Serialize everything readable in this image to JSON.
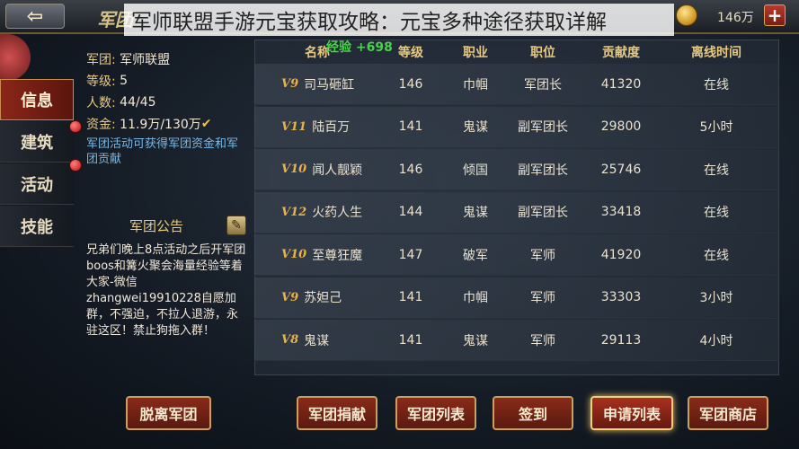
{
  "header": {
    "back_label": "⇦",
    "page_title": "军团",
    "overlay_title": "军师联盟手游元宝获取攻略：元宝多种途径获取详解",
    "currency": "146万",
    "plus_label": "+"
  },
  "sidebar": {
    "items": [
      {
        "label": "信息"
      },
      {
        "label": "建筑"
      },
      {
        "label": "活动"
      },
      {
        "label": "技能"
      }
    ]
  },
  "info": {
    "legion_key": "军团:",
    "legion_val": "军师联盟",
    "level_key": "等级:",
    "level_val": "5",
    "members_key": "人数:",
    "members_val": "44/45",
    "funds_key": "资金:",
    "funds_val": "11.9万/130万",
    "note": "军团活动可获得军团资金和军团贡献"
  },
  "notice": {
    "title": "军团公告",
    "body": "兄弟们晚上8点活动之后开军团boos和篝火聚会海量经验等着大家-微信zhangwei19910228自愿加群，不强迫，不拉人退游，永驻这区！禁止狗拖入群！"
  },
  "exp_tip": "经验 +698",
  "table": {
    "headers": [
      "名称",
      "等级",
      "职业",
      "职位",
      "贡献度",
      "离线时间"
    ],
    "rows": [
      {
        "vip": "V9",
        "name": "司马砸缸",
        "level": "146",
        "job": "巾帼",
        "post": "军团长",
        "contrib": "41320",
        "offline": "在线"
      },
      {
        "vip": "V11",
        "name": "陆百万",
        "level": "141",
        "job": "鬼谋",
        "post": "副军团长",
        "contrib": "29800",
        "offline": "5小时"
      },
      {
        "vip": "V10",
        "name": "闻人靓颖",
        "level": "146",
        "job": "倾国",
        "post": "副军团长",
        "contrib": "25746",
        "offline": "在线"
      },
      {
        "vip": "V12",
        "name": "火药人生",
        "level": "144",
        "job": "鬼谋",
        "post": "副军团长",
        "contrib": "33418",
        "offline": "在线"
      },
      {
        "vip": "V10",
        "name": "至尊狂魔",
        "level": "147",
        "job": "破军",
        "post": "军师",
        "contrib": "41920",
        "offline": "在线"
      },
      {
        "vip": "V9",
        "name": "苏妲己",
        "level": "141",
        "job": "巾帼",
        "post": "军师",
        "contrib": "33303",
        "offline": "3小时"
      },
      {
        "vip": "V8",
        "name": "鬼谋",
        "level": "141",
        "job": "鬼谋",
        "post": "军师",
        "contrib": "29113",
        "offline": "4小时"
      }
    ]
  },
  "buttons": {
    "leave": "脱离军团",
    "donate": "军团捐献",
    "list": "军团列表",
    "signin": "签到",
    "requests": "申请列表",
    "shop": "军团商店"
  }
}
